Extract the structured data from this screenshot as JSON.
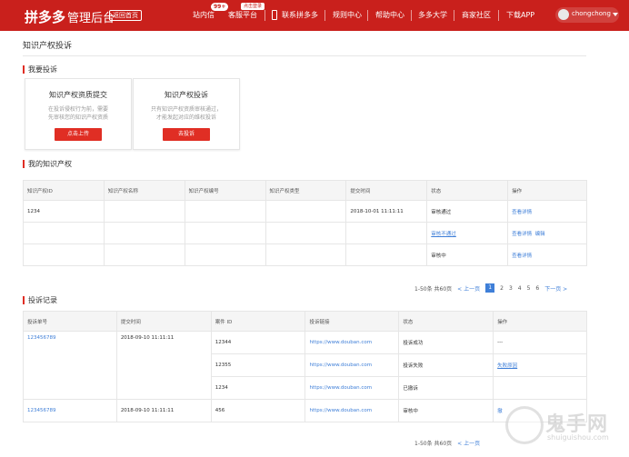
{
  "header": {
    "logo": "拼多多",
    "logo_sub": "管理后台",
    "home_button": "返回首页",
    "nav": {
      "messages": "站内信",
      "messages_badge": "99+",
      "service": "客服平台",
      "service_hint": "点击登录",
      "contact": "联系拼多多",
      "rules": "规则中心",
      "help": "帮助中心",
      "university": "多多大学",
      "community": "商家社区",
      "download": "下载APP"
    },
    "username": "chongchong"
  },
  "page": {
    "title": "知识产权投诉"
  },
  "complaint": {
    "section_title": "我要投诉",
    "cards": [
      {
        "title": "知识产权资质提交",
        "desc_1": "在投诉侵权行为前，需要",
        "desc_2": "先审核您的知识产权资质",
        "button": "点击上传"
      },
      {
        "title": "知识产权投诉",
        "desc_1": "只有知识产权资质审核通过，",
        "desc_2": "才能发起对应的维权投诉",
        "button": "去投诉"
      }
    ]
  },
  "ip": {
    "section_title": "我的知识产权",
    "columns": [
      "知识产权ID",
      "知识产权名称",
      "知识产权编号",
      "知识产权类型",
      "提交时间",
      "状态",
      "操作"
    ],
    "rows": [
      {
        "id": "1234",
        "time": "2018-10-01 11:11:11",
        "status": "审核通过",
        "action": "查看详情",
        "action2": ""
      },
      {
        "id": "",
        "time": "",
        "status": "审核不通过",
        "action": "查看详情",
        "action2": "编辑"
      },
      {
        "id": "",
        "time": "",
        "status": "审核中",
        "action": "查看详情",
        "action2": ""
      }
    ],
    "pager": {
      "summary": "1-50条 共60页",
      "prev": "< 上一页",
      "pages": [
        "1",
        "2",
        "3",
        "4",
        "5",
        "6"
      ],
      "next": "下一页 >"
    }
  },
  "records": {
    "section_title": "投诉记录",
    "columns": [
      "投诉单号",
      "提交时间",
      "案件 ID",
      "投诉链接",
      "状态",
      "操作"
    ],
    "groups": [
      {
        "no": "123456789",
        "time": "2018-09-10 11:11:11",
        "cases": [
          {
            "id": "12344",
            "link": "https://www.douban.com",
            "status": "投诉成功",
            "action": "---"
          },
          {
            "id": "12355",
            "link": "https://www.douban.com",
            "status": "投诉失败",
            "action": "失败原因"
          },
          {
            "id": "1234",
            "link": "https://www.douban.com",
            "status": "已撤诉",
            "action": ""
          }
        ]
      },
      {
        "no": "123456789",
        "time": "2018-09-10 11:11:11",
        "cases": [
          {
            "id": "456",
            "link": "https://www.douban.com",
            "status": "审核中",
            "action": "撤"
          }
        ]
      }
    ],
    "pager": {
      "summary": "1-50条 共60页",
      "prev": "< 上一页"
    }
  },
  "watermark": {
    "text": "鬼手网",
    "sub": "shuiguishou.com"
  },
  "colors": {
    "brand": "#c9201c",
    "button": "#e02e24",
    "link": "#3f7fd8"
  }
}
